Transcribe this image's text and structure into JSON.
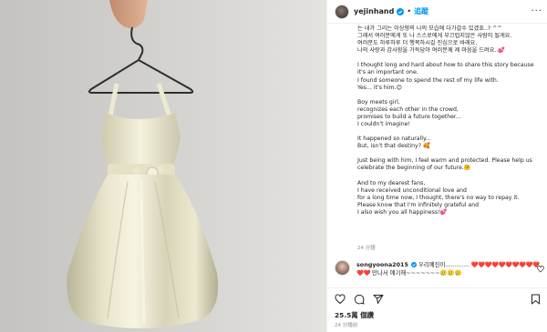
{
  "colors": {
    "link": "#0095f6",
    "heart": "#ed4956",
    "muted": "#8e8e8e",
    "text": "#262626"
  },
  "icons": [
    "verified-badge-icon",
    "more-options-icon",
    "like-icon",
    "comment-icon",
    "share-icon",
    "bookmark-icon",
    "comment-like-icon"
  ],
  "header": {
    "username": "yejinhand",
    "separator": "•",
    "follow_label": "追蹤",
    "more": "···"
  },
  "caption": {
    "lines_ko": "는 내가 그리는 이상향의 나의 모습에 다가갈수 있겠죠..? ^^\n그래서 여러분에게 또 나 스스로에게 부끄럽지않은 사람이 될게요.\n여러분도 하루하루 더 행복하시길 진심으로 바래요.\n나의 사랑과 감사함을 가득담아 여러분께 제 마음을 드려요..💕",
    "para1": "I thought long and hard about how to share this story because it's an important one.\nI found someone to spend the rest of my life with.\nYes... it's him.😊",
    "para2": "Boy meets girl,\nrecognizes each other in the crowd,\npromises to build a future together...\nI couldn't imagine!",
    "para3": "It happened so naturally...\nBut, isn't that destiny? 🥰",
    "para4": "Just being with him, I feel warm and protected. Please help us celebrate the beginning of our future.🤗",
    "para5": "And to my dearest fans,\nI have received unconditional love and\nfor a long time now, I thought, there's no way to repay it.\nPlease know that I'm infinitely grateful and\nI also wish you all happiness!💕",
    "time": "24 分鐘"
  },
  "comment": {
    "username": "songyoona2015",
    "verified_mark": "✓",
    "text_start": "우리예진이.............",
    "hearts": "❤️❤️❤️❤️❤️❤️❤️❤️❤️❤️❤️❤️",
    "text_end": "만나서 얘기해~~~~~~~🥲🥲🥲"
  },
  "post": {
    "likes": "25.5萬 個讚",
    "time": "24 分鐘前"
  }
}
